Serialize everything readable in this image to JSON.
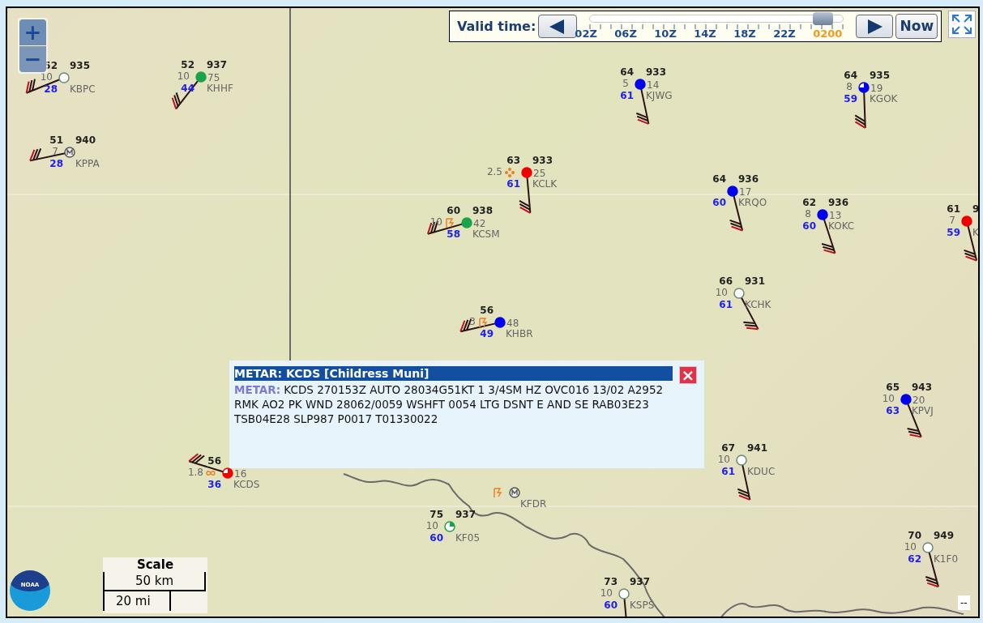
{
  "time_control": {
    "label": "Valid time:",
    "level": 0.92,
    "ticks": [
      {
        "label": "02Z",
        "selected": false
      },
      {
        "label": "06Z",
        "selected": false
      },
      {
        "label": "10Z",
        "selected": false
      },
      {
        "label": "14Z",
        "selected": false
      },
      {
        "label": "18Z",
        "selected": false
      },
      {
        "label": "22Z",
        "selected": false
      },
      {
        "label": "0200",
        "selected": true
      }
    ],
    "now_button": "Now"
  },
  "zoom": {
    "in": "+",
    "out": "−"
  },
  "stations": [
    {
      "id": "KBPC",
      "temp": "52",
      "pressure": "935",
      "visibility": "10",
      "dewpoint": "28",
      "kind": "clear",
      "color": "#ffffff"
    },
    {
      "id": "KHHF",
      "temp": "52",
      "pressure": "937",
      "visibility": "10",
      "right_value": "75",
      "dewpoint": "44",
      "kind": "overcast",
      "color": "#1aa34a"
    },
    {
      "id": "KPPA",
      "temp": "51",
      "pressure": "940",
      "visibility": "7",
      "dewpoint": "28",
      "kind": "missing",
      "color": "#555555"
    },
    {
      "id": "KJWG",
      "temp": "64",
      "pressure": "933",
      "visibility": "5",
      "right_value": "14",
      "dewpoint": "61",
      "kind": "overcast",
      "color": "#0000ee"
    },
    {
      "id": "KGOK",
      "temp": "64",
      "pressure": "935",
      "visibility": "8",
      "right_value": "19",
      "dewpoint": "59",
      "kind": "broken",
      "color": "#0000ee"
    },
    {
      "id": "KCLK",
      "temp": "63",
      "pressure": "933",
      "visibility": "2.5",
      "right_value": "25",
      "dewpoint": "61",
      "kind": "overcast",
      "color": "#ee0000",
      "weather": {
        "kind": "rain"
      }
    },
    {
      "id": "KCSM",
      "temp": "60",
      "pressure": "938",
      "visibility": "10",
      "right_value": "42",
      "dewpoint": "58",
      "kind": "overcast",
      "color": "#1aa34a",
      "weather": {
        "kind": "thunderstorm"
      }
    },
    {
      "id": "KRQO",
      "temp": "64",
      "pressure": "936",
      "right_value": "17",
      "dewpoint": "60",
      "kind": "overcast",
      "color": "#0000ee"
    },
    {
      "id": "KOKC",
      "temp": "62",
      "pressure": "936",
      "visibility": "8",
      "right_value": "13",
      "dewpoint": "60",
      "kind": "overcast",
      "color": "#0000ee"
    },
    {
      "id": "K",
      "temp": "61",
      "pressure": "9",
      "visibility": "7",
      "dewpoint": "59",
      "kind": "overcast",
      "color": "#ee0000"
    },
    {
      "id": "KCHK",
      "temp": "66",
      "pressure": "931",
      "visibility": "10",
      "dewpoint": "61",
      "kind": "clear",
      "color": "#ffffff"
    },
    {
      "id": "KHBR",
      "temp": "56",
      "visibility": "3",
      "right_value": "48",
      "dewpoint": "49",
      "kind": "overcast",
      "color": "#0000ee",
      "weather": {
        "kind": "thunderstorm"
      }
    },
    {
      "id": "KCDS",
      "temp": "56",
      "visibility": "1.8",
      "right_value": "16",
      "dewpoint": "36",
      "kind": "broken",
      "color": "#ee0000",
      "weather": {
        "kind": "haze"
      }
    },
    {
      "id": "KPVJ",
      "temp": "65",
      "pressure": "943",
      "visibility": "10",
      "right_value": "20",
      "dewpoint": "63",
      "kind": "overcast",
      "color": "#0000ee"
    },
    {
      "id": "KDUC",
      "temp": "67",
      "pressure": "941",
      "visibility": "10",
      "dewpoint": "61",
      "kind": "clear",
      "color": "#ffffff"
    },
    {
      "id": "KFDR",
      "kind": "missing",
      "color": "#555555",
      "weather": {
        "kind": "thunderstorm"
      }
    },
    {
      "id": "KF05",
      "temp": "75",
      "pressure": "937",
      "visibility": "10",
      "dewpoint": "60",
      "kind": "few",
      "color": "#1aa34a"
    },
    {
      "id": "K1F0",
      "temp": "70",
      "pressure": "949",
      "visibility": "10",
      "dewpoint": "62",
      "kind": "clear",
      "color": "#ffffff"
    },
    {
      "id": "KSPS",
      "temp": "73",
      "pressure": "937",
      "visibility": "10",
      "dewpoint": "60",
      "kind": "clear",
      "color": "#ffffff"
    }
  ],
  "popup": {
    "title": "METAR: KCDS [Childress Muni]",
    "label": "METAR:",
    "text": "KCDS 270153Z AUTO 28034G51KT 1 3/4SM HZ OVC016 13/02 A2952 RMK AO2 PK WND 28062/0059 WSHFT 0054 LTG DSNT E AND SE RAB03E23 TSB04E28 SLP987 P0017 T01330022",
    "close": "×"
  },
  "scale": {
    "title": "Scale",
    "metric": "50 km",
    "imperial": "20 mi"
  },
  "logo": {
    "text": "NOAA"
  },
  "corner_label": "--"
}
